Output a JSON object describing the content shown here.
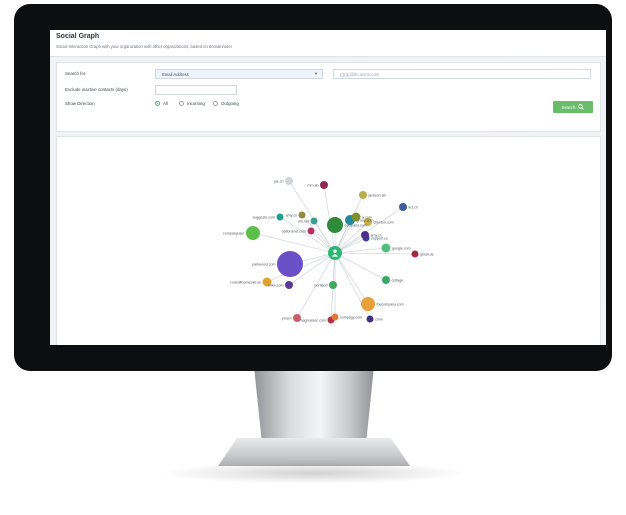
{
  "app": {
    "title": "Social Graph",
    "subtitle": "Social Interaction Graph with your organization with other organizations, based on domain/user"
  },
  "form": {
    "search_for_label": "Search for",
    "search_type_value": "Email Address",
    "search_value": "(((((((@tfe.acme.com",
    "exclude_label": "Exclude inactive contacts (days)",
    "exclude_value": "",
    "direction_label": "Show Direction",
    "directions": [
      {
        "label": "All",
        "selected": true
      },
      {
        "label": "Incoming",
        "selected": false
      },
      {
        "label": "Outgoing",
        "selected": false
      }
    ],
    "search_button": "Search",
    "search_icon": "magnifier-icon"
  },
  "graph": {
    "center_icon": "user-icon",
    "nodes": [
      {
        "label": "joe.ch",
        "color": "#cfd4d9",
        "r": 4
      },
      {
        "label": "mm.ab",
        "color": "#8e2a54",
        "r": 4
      },
      {
        "label": "jackson.ab",
        "color": "#b5ad4e",
        "r": 4
      },
      {
        "label": "krs.ch",
        "color": "#3b5a9a",
        "r": 4
      },
      {
        "label": "suggeste.com",
        "color": "#1aa08c",
        "r": 3.5
      },
      {
        "label": "amy.co",
        "color": "#8f8a3e",
        "r": 3.5
      },
      {
        "label": "mh.net",
        "color": "#37a28f",
        "r": 3.5
      },
      {
        "label": "clienton.com",
        "color": "#c9b13f",
        "r": 4
      },
      {
        "label": "group.com",
        "color": "#1d8aa0",
        "r": 5
      },
      {
        "label": "company.com",
        "color": "#2f8a3c",
        "r": 8
      },
      {
        "label": "a.com",
        "color": "#7f8f2e",
        "r": 4.5
      },
      {
        "label": "support.co",
        "color": "#3f3f8f",
        "r": 3.5
      },
      {
        "label": "companyuser",
        "color": "#5bbf4a",
        "r": 7
      },
      {
        "label": "optionsnet.com",
        "color": "#b0345f",
        "r": 3.5
      },
      {
        "label": "google.com",
        "color": "#4fbf7f",
        "r": 4.5
      },
      {
        "label": "gmail.de",
        "color": "#a52040",
        "r": 3.5
      },
      {
        "label": "amy.co",
        "color": "#4a2f8f",
        "r": 4
      },
      {
        "label": "parkwood.com",
        "color": "#6a4fc6",
        "r": 13
      },
      {
        "label": "cottage",
        "color": "#38a863",
        "r": 4
      },
      {
        "label": "consulthomesab.se",
        "color": "#e0a42e",
        "r": 4.5
      },
      {
        "label": "mike.com",
        "color": "#5a3b9a",
        "r": 4
      },
      {
        "label": "portland",
        "color": "#3fa85c",
        "r": 4
      },
      {
        "label": "pmcm",
        "color": "#c95f6a",
        "r": 4
      },
      {
        "label": "thecompany.com",
        "color": "#e8a03a",
        "r": 7
      },
      {
        "label": "magnussen.com",
        "color": "#b53047",
        "r": 3.5
      },
      {
        "label": "compagy.com",
        "color": "#e07a35",
        "r": 3.5
      },
      {
        "label": "cmm",
        "color": "#3f2f7f",
        "r": 3.5
      }
    ]
  }
}
